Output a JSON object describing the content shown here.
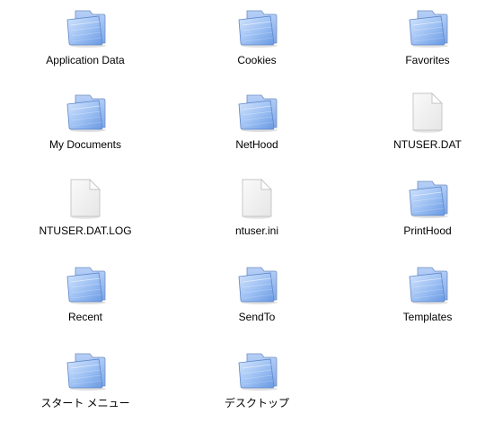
{
  "window": {
    "view": "icon-view"
  },
  "colors": {
    "background": "#ffffff",
    "label": "#000000",
    "folder_front_light": "#c7dcfa",
    "folder_front_dark": "#6f9fe6",
    "folder_back": "#8fb4ee",
    "folder_outline": "#6f8fc0",
    "doc_fill": "#f4f4f4",
    "doc_outline": "#c8c8c8"
  },
  "items": [
    {
      "label": "Application Data",
      "icon": "folder-icon"
    },
    {
      "label": "Cookies",
      "icon": "folder-icon"
    },
    {
      "label": "Favorites",
      "icon": "folder-icon"
    },
    {
      "label": "My Documents",
      "icon": "folder-icon"
    },
    {
      "label": "NetHood",
      "icon": "folder-icon"
    },
    {
      "label": "NTUSER.DAT",
      "icon": "document-icon"
    },
    {
      "label": "NTUSER.DAT.LOG",
      "icon": "document-icon"
    },
    {
      "label": "ntuser.ini",
      "icon": "document-icon"
    },
    {
      "label": "PrintHood",
      "icon": "folder-icon"
    },
    {
      "label": "Recent",
      "icon": "folder-icon"
    },
    {
      "label": "SendTo",
      "icon": "folder-icon"
    },
    {
      "label": "Templates",
      "icon": "folder-icon"
    },
    {
      "label": "スタート メニュー",
      "icon": "folder-icon"
    },
    {
      "label": "デスクトップ",
      "icon": "folder-icon"
    }
  ]
}
